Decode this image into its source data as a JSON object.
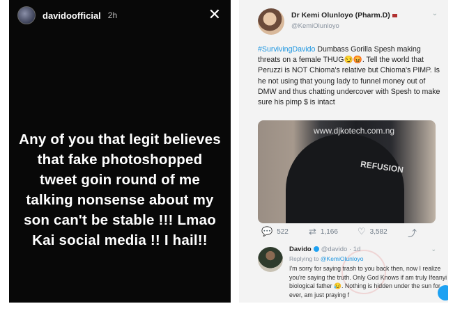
{
  "story": {
    "username": "davidoofficial",
    "time": "2h",
    "close_icon": "close-icon",
    "caption": "Any of you that legit believes that fake photoshopped tweet goin round of me talking nonsense about my son can't be stable !!! Lmao Kai social media !! I hail!!"
  },
  "tweet": {
    "author_name": "Dr Kemi Olunloyo (Pharm.D)",
    "handle": "@KemiOlunloyo",
    "hashtag": "#SurvivingDavido",
    "text": " Dumbass Gorilla Spesh making threats on a female THUG😏😡. Tell the world that Peruzzi is NOT Chioma's relative but Chioma's PIMP. Is he not using that young lady to funnel money out of DMW and thus chatting undercover with Spesh to make sure his pimp $ is intact",
    "image_watermark": "www.djkotech.com.ng",
    "image_brand": "REFUSION",
    "actions": {
      "replies": "522",
      "retweets": "1,166",
      "likes": "3,582"
    }
  },
  "reply": {
    "name": "Davido",
    "handle": "@davido",
    "time": "1d",
    "replying_label": "Replying to",
    "replying_to": "@KemiOlunloyo",
    "text": "I'm sorry for saying trash to you back then, now I realize you're saying the truth. Only God Knows if am truly Ifeanyi biological father 😥. Nothing is hidden under the sun for ever, am just praying f"
  }
}
